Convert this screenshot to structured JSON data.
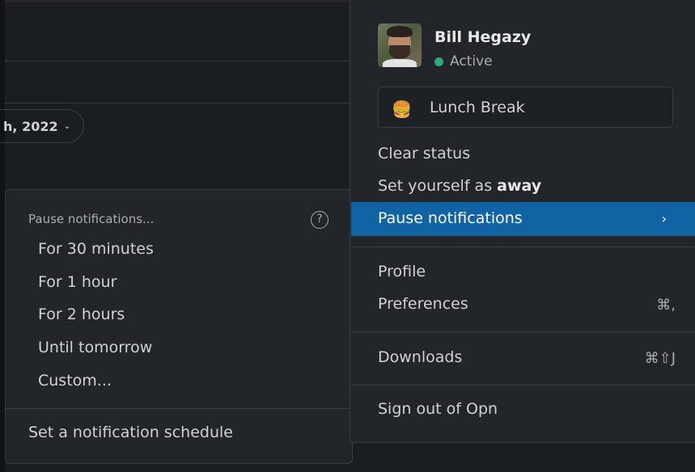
{
  "background": {
    "date_pill": "h, 2022",
    "date_pill_chevron": "chevron-down-icon"
  },
  "submenu": {
    "header": "Pause notifications...",
    "help_icon": "?",
    "options": [
      "For 30 minutes",
      "For 1 hour",
      "For 2 hours",
      "Until tomorrow",
      "Custom..."
    ],
    "schedule": "Set a notification schedule"
  },
  "user": {
    "name": "Bill Hegazy",
    "presence": "Active",
    "presence_color": "#2bac76"
  },
  "status": {
    "emoji": "🍔",
    "text": "Lunch Break"
  },
  "menu": {
    "clear_status": "Clear status",
    "set_away_prefix": "Set yourself as ",
    "set_away_bold": "away",
    "pause_notifications": "Pause notifications",
    "pause_arrow": "›",
    "profile": "Profile",
    "preferences": "Preferences",
    "preferences_shortcut": "⌘,",
    "downloads": "Downloads",
    "downloads_shortcut": "⌘⇧J",
    "sign_out": "Sign out of Opn"
  },
  "colors": {
    "highlight": "#1164a3",
    "panel": "#222529",
    "background": "#1a1d21"
  }
}
